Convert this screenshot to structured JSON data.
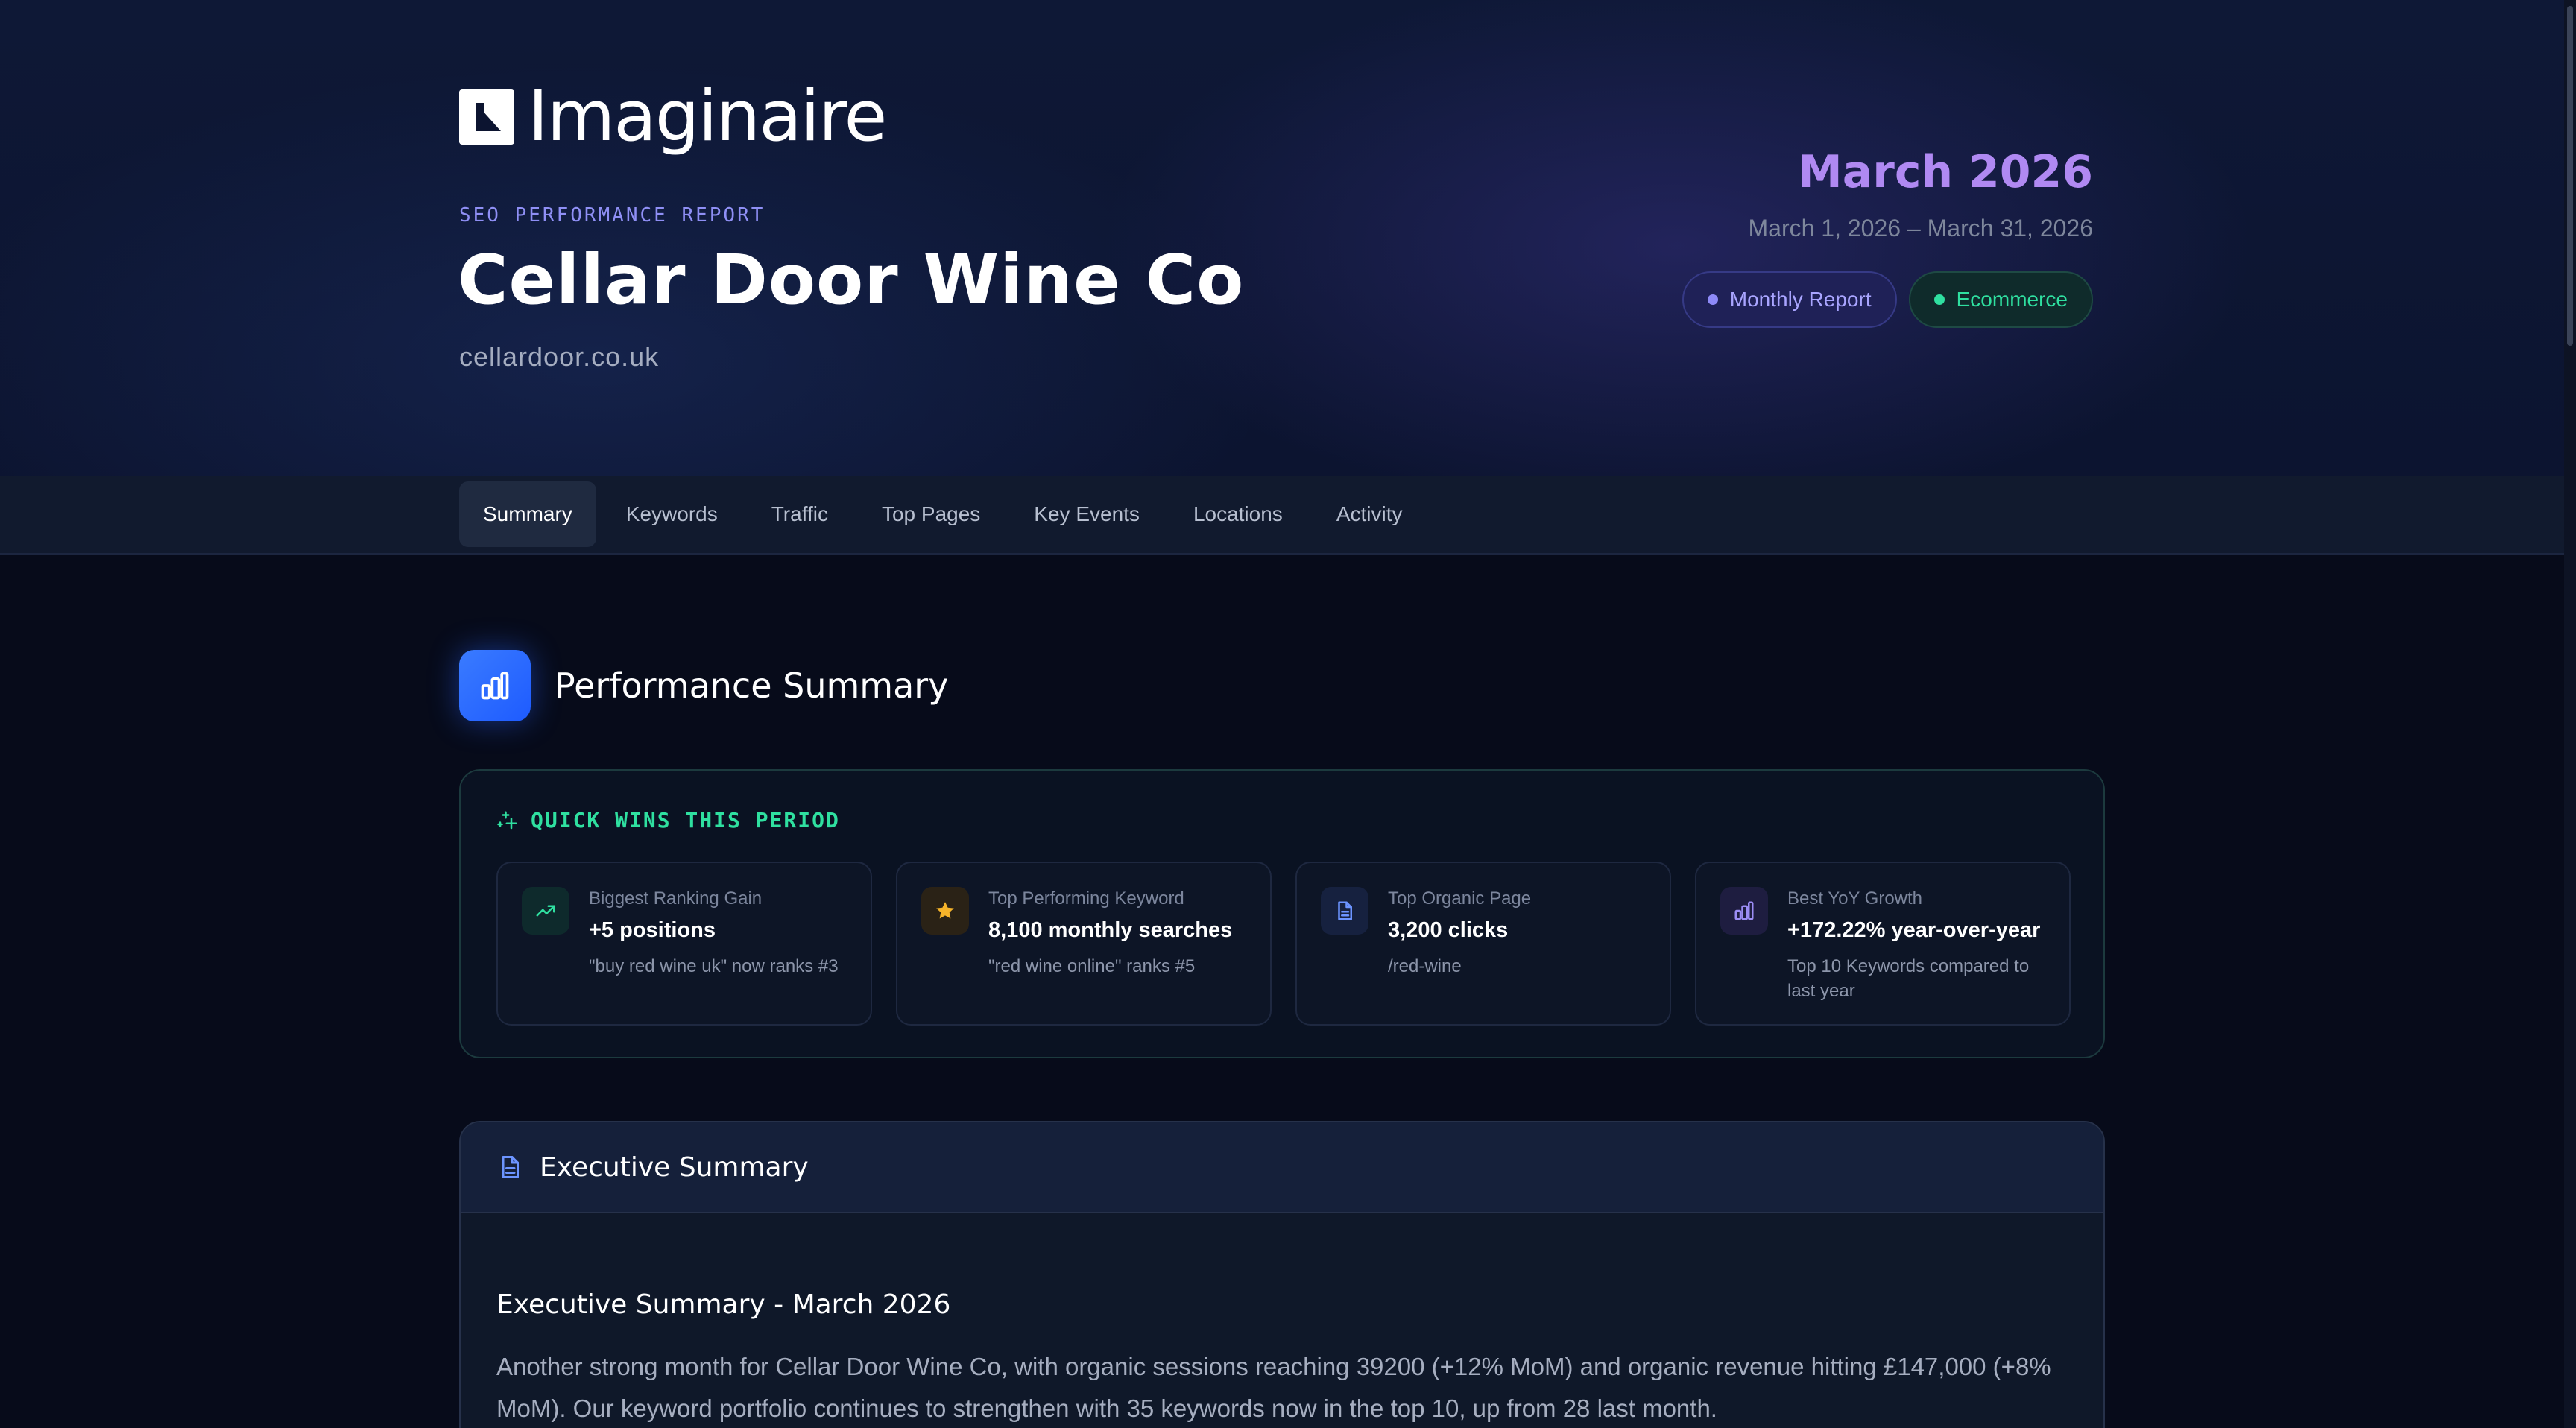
{
  "brand": {
    "name": "Imaginaire"
  },
  "report": {
    "type_label": "SEO PERFORMANCE REPORT",
    "client_name": "Cellar Door Wine Co",
    "client_domain": "cellardoor.co.uk",
    "period": "March 2026",
    "period_range": "March 1, 2026 – March 31, 2026",
    "badges": [
      {
        "label": "Monthly Report",
        "color": "#8e8af8"
      },
      {
        "label": "Ecommerce",
        "color": "#2fe0a0"
      }
    ]
  },
  "tabs": [
    {
      "label": "Summary",
      "active": true
    },
    {
      "label": "Keywords"
    },
    {
      "label": "Traffic"
    },
    {
      "label": "Top Pages"
    },
    {
      "label": "Key Events"
    },
    {
      "label": "Locations"
    },
    {
      "label": "Activity"
    }
  ],
  "performance": {
    "title": "Performance Summary",
    "quick_wins": {
      "title": "QUICK WINS THIS PERIOD",
      "cards": [
        {
          "label": "Biggest Ranking Gain",
          "value": "+5 positions",
          "desc": "\"buy red wine uk\" now ranks #3",
          "icon": "trending-up-icon"
        },
        {
          "label": "Top Performing Keyword",
          "value": "8,100 monthly searches",
          "desc": "\"red wine online\" ranks #5",
          "icon": "star-icon"
        },
        {
          "label": "Top Organic Page",
          "value": "3,200 clicks",
          "desc": "/red-wine",
          "icon": "document-icon"
        },
        {
          "label": "Best YoY Growth",
          "value": "+172.22% year-over-year",
          "desc": "Top 10 Keywords compared to last year",
          "icon": "bar-chart-icon"
        }
      ]
    }
  },
  "executive_summary": {
    "header": "Executive Summary",
    "subtitle": "Executive Summary - March 2026",
    "body": "Another strong month for Cellar Door Wine Co, with organic sessions reaching 39200 (+12% MoM) and organic revenue hitting £147,000 (+8% MoM). Our keyword portfolio continues to strengthen with 35 keywords now in the top 10, up from 28 last month."
  },
  "colors": {
    "accent_purple": "#b089f2",
    "accent_green": "#2fe0a0",
    "accent_blue": "#2a6bff",
    "background": "#070b1a"
  }
}
